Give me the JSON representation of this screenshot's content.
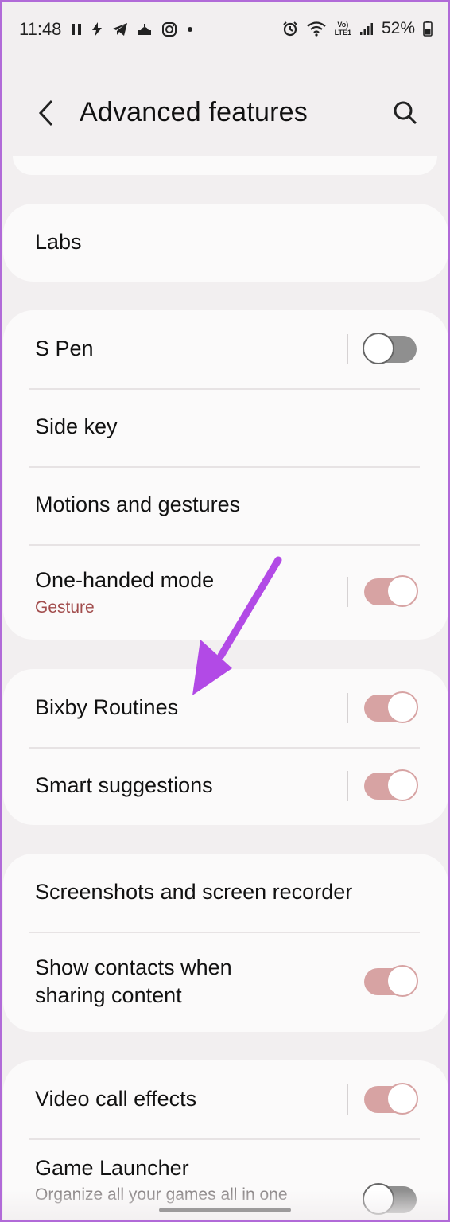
{
  "status_bar": {
    "time": "11:48",
    "battery": "52%",
    "lte_label": "LTE1"
  },
  "app_bar": {
    "title": "Advanced features"
  },
  "groups": [
    {
      "items": [
        {
          "label": "Labs"
        }
      ]
    },
    {
      "items": [
        {
          "label": "S Pen",
          "toggle": "off"
        },
        {
          "label": "Side key"
        },
        {
          "label": "Motions and gestures"
        },
        {
          "label": "One-handed mode",
          "sub": "Gesture",
          "toggle": "on"
        }
      ]
    },
    {
      "items": [
        {
          "label": "Bixby Routines",
          "toggle": "on"
        },
        {
          "label": "Smart suggestions",
          "toggle": "on"
        }
      ]
    },
    {
      "items": [
        {
          "label": "Screenshots and screen recorder"
        },
        {
          "label": "Show contacts when",
          "label2": "sharing content",
          "toggle": "on"
        }
      ]
    },
    {
      "items": [
        {
          "label": "Video call effects",
          "toggle": "on"
        },
        {
          "label": "Game Launcher",
          "sub": "Organize all your games all in one",
          "toggle": "off"
        }
      ]
    }
  ],
  "annotation": {
    "arrow_color": "#b24ae6"
  },
  "colors": {
    "accent": "#d7a3a3",
    "subtext": "#a24d4d",
    "background": "#f2eff0"
  }
}
